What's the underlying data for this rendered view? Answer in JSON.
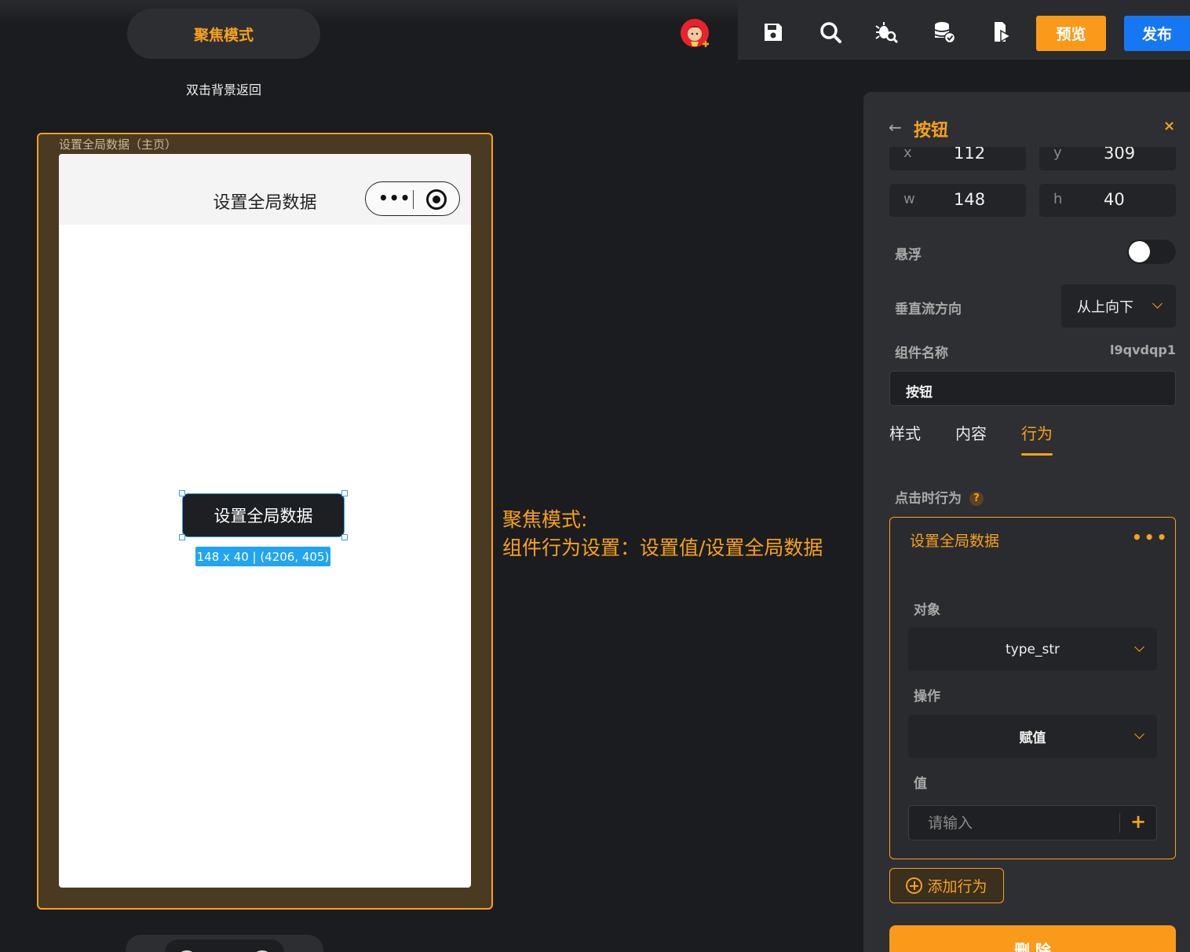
{
  "focus_mode": {
    "label": "聚焦模式",
    "hint": "双击背景返回"
  },
  "toolbar": {
    "icons": [
      "user-avatar-icon",
      "save-icon",
      "search-icon",
      "bug-search-icon",
      "database-check-icon",
      "export-play-icon"
    ],
    "preview_label": "预览",
    "publish_label": "发布"
  },
  "canvas": {
    "page_label": "设置全局数据（主页）",
    "phone_title": "设置全局数据",
    "capsule_menu": "•••",
    "button_label": "设置全局数据",
    "size_tag": "148 x 40 | (4206, 405)"
  },
  "annotation": {
    "line1": "聚焦模式:",
    "line2": "组件行为设置：设置值/设置全局数据"
  },
  "panel": {
    "title": "按钮",
    "close": "×",
    "fields": {
      "x_label": "x",
      "x_value": "112",
      "y_label": "y",
      "y_value": "309",
      "w_label": "w",
      "w_value": "148",
      "h_label": "h",
      "h_value": "40"
    },
    "float_label": "悬浮",
    "float_on": false,
    "flow_label": "垂直流方向",
    "flow_value": "从上向下",
    "name_label": "组件名称",
    "name_id": "l9qvdqp1",
    "name_value": "按钮",
    "tabs": [
      "样式",
      "内容",
      "行为"
    ],
    "active_tab": "行为",
    "click_behavior_label": "点击时行为",
    "help_icon": "?",
    "action": {
      "title": "设置全局数据",
      "more": "•••",
      "object_label": "对象",
      "object_value": "type_str",
      "operation_label": "操作",
      "operation_value": "赋值",
      "value_label": "值",
      "value_placeholder": "请输入",
      "value_add": "+"
    },
    "add_action_label": "添加行为",
    "delete_label": "删 除"
  }
}
